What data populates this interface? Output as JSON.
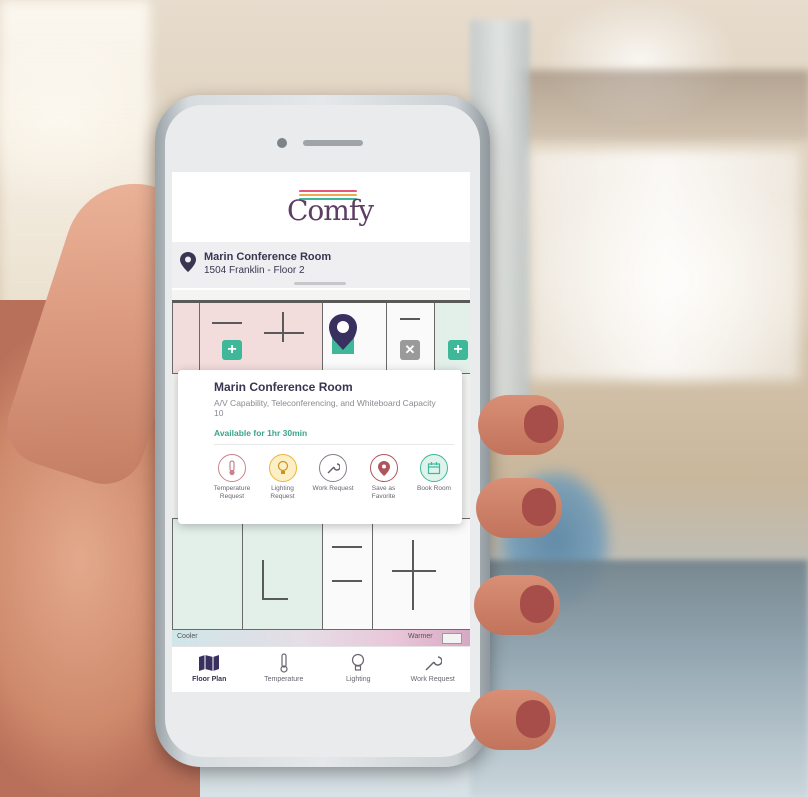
{
  "app": {
    "logo_text": "Comfy",
    "brand_colors": [
      "#e8567a",
      "#f0a84a",
      "#3fb89a",
      "#5d3f63"
    ]
  },
  "location": {
    "room_name": "Marin Conference Room",
    "address": "1504 Franklin - Floor 2"
  },
  "room_card": {
    "title": "Marin Conference Room",
    "description": "A/V Capability, Teleconferencing, and Whiteboard Capacity 10",
    "availability": "Available for 1hr 30min",
    "actions": [
      {
        "label": "Temperature Request",
        "icon": "thermometer-icon",
        "color": "#c9838f"
      },
      {
        "label": "Lighting Request",
        "icon": "lightbulb-icon",
        "color": "#e9b53a"
      },
      {
        "label": "Work Request",
        "icon": "wrench-icon",
        "color": "#6a5870"
      },
      {
        "label": "Save as Favorite",
        "icon": "favorite-pin-icon",
        "color": "#b0545c"
      },
      {
        "label": "Book Room",
        "icon": "calendar-icon",
        "color": "#3fb89a"
      }
    ]
  },
  "legend": {
    "cooler_label": "Cooler",
    "warmer_label": "Warmer"
  },
  "bottom_nav": {
    "items": [
      {
        "label": "Floor Plan",
        "icon": "floor-plan-icon",
        "active": true
      },
      {
        "label": "Temperature",
        "icon": "thermometer-icon",
        "active": false
      },
      {
        "label": "Lighting",
        "icon": "lightbulb-icon",
        "active": false
      },
      {
        "label": "Work Request",
        "icon": "wrench-icon",
        "active": false
      }
    ]
  }
}
